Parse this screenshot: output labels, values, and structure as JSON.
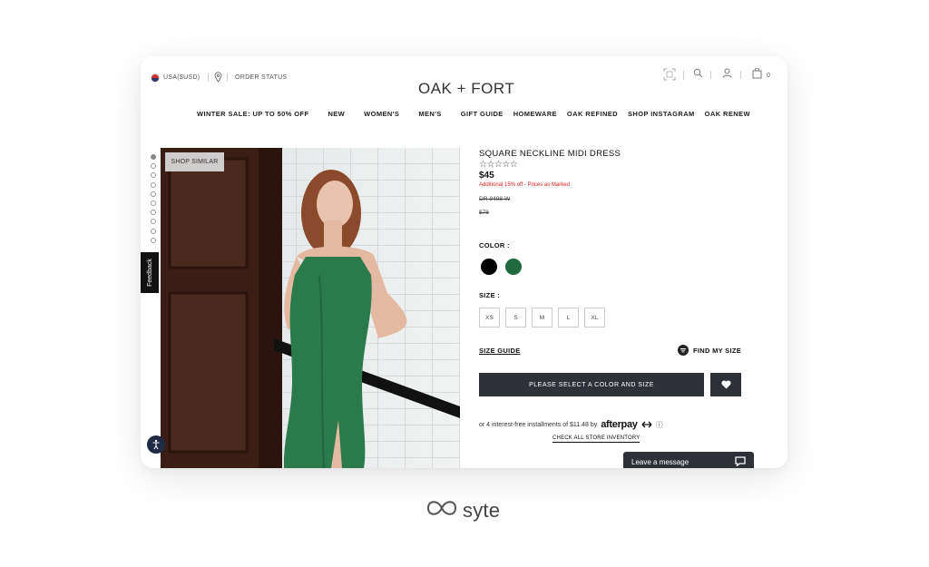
{
  "topbar": {
    "region": "USA($USD)",
    "order_status": "ORDER STATUS",
    "cart_count": "0"
  },
  "logo": "OAK + FORT",
  "nav": [
    "WINTER SALE: UP TO 50% OFF",
    "NEW",
    "WOMEN'S",
    "MEN'S",
    "GIFT GUIDE",
    "HOMEWARE",
    "OAK REFINED",
    "SHOP INSTAGRAM",
    "OAK RENEW"
  ],
  "gallery": {
    "shop_similar": "SHOP SIMILAR",
    "feedback": "Feedback",
    "thumb_count": 10,
    "active_thumb": 0
  },
  "product": {
    "title": "SQUARE NECKLINE MIDI DRESS",
    "stars": "☆☆☆☆☆",
    "price": "$45",
    "promo": "Additional 15% off - Prices as Marked",
    "sku": "DR-9498-W",
    "original_price": "$78",
    "color_label": "COLOR :",
    "colors": [
      "#000000",
      "#1f6b3f"
    ],
    "size_label": "SIZE :",
    "sizes": [
      "XS",
      "S",
      "M",
      "L",
      "XL"
    ],
    "size_guide": "SIZE GUIDE",
    "find_my_size": "FIND MY SIZE",
    "cta": "PLEASE SELECT A COLOR AND SIZE",
    "installments": "or 4 interest-free installments of $11.48 by",
    "afterpay": "afterpay",
    "store_inventory": "CHECK ALL STORE INVENTORY"
  },
  "chat": {
    "label": "Leave a message"
  },
  "brand": {
    "name": "syte"
  }
}
